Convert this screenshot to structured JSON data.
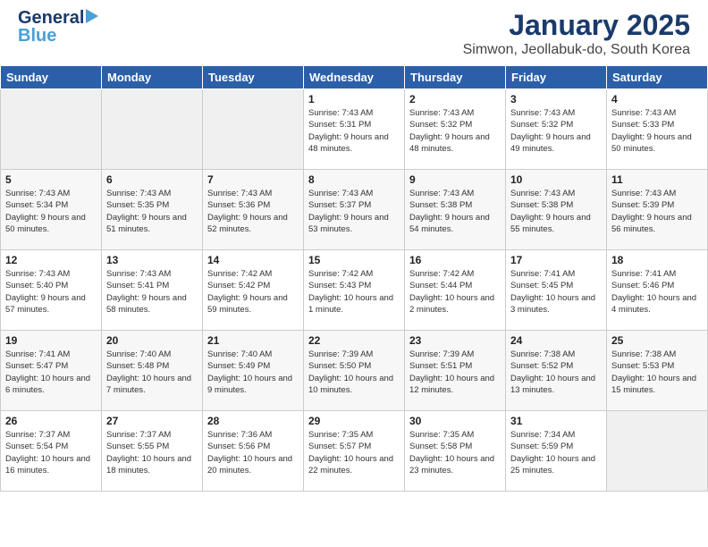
{
  "header": {
    "logo_line1": "General",
    "logo_line2": "Blue",
    "title": "January 2025",
    "subtitle": "Simwon, Jeollabuk-do, South Korea"
  },
  "weekdays": [
    "Sunday",
    "Monday",
    "Tuesday",
    "Wednesday",
    "Thursday",
    "Friday",
    "Saturday"
  ],
  "weeks": [
    [
      {
        "day": "",
        "sunrise": "",
        "sunset": "",
        "daylight": "",
        "empty": true
      },
      {
        "day": "",
        "sunrise": "",
        "sunset": "",
        "daylight": "",
        "empty": true
      },
      {
        "day": "",
        "sunrise": "",
        "sunset": "",
        "daylight": "",
        "empty": true
      },
      {
        "day": "1",
        "sunrise": "Sunrise: 7:43 AM",
        "sunset": "Sunset: 5:31 PM",
        "daylight": "Daylight: 9 hours and 48 minutes."
      },
      {
        "day": "2",
        "sunrise": "Sunrise: 7:43 AM",
        "sunset": "Sunset: 5:32 PM",
        "daylight": "Daylight: 9 hours and 48 minutes."
      },
      {
        "day": "3",
        "sunrise": "Sunrise: 7:43 AM",
        "sunset": "Sunset: 5:32 PM",
        "daylight": "Daylight: 9 hours and 49 minutes."
      },
      {
        "day": "4",
        "sunrise": "Sunrise: 7:43 AM",
        "sunset": "Sunset: 5:33 PM",
        "daylight": "Daylight: 9 hours and 50 minutes."
      }
    ],
    [
      {
        "day": "5",
        "sunrise": "Sunrise: 7:43 AM",
        "sunset": "Sunset: 5:34 PM",
        "daylight": "Daylight: 9 hours and 50 minutes."
      },
      {
        "day": "6",
        "sunrise": "Sunrise: 7:43 AM",
        "sunset": "Sunset: 5:35 PM",
        "daylight": "Daylight: 9 hours and 51 minutes."
      },
      {
        "day": "7",
        "sunrise": "Sunrise: 7:43 AM",
        "sunset": "Sunset: 5:36 PM",
        "daylight": "Daylight: 9 hours and 52 minutes."
      },
      {
        "day": "8",
        "sunrise": "Sunrise: 7:43 AM",
        "sunset": "Sunset: 5:37 PM",
        "daylight": "Daylight: 9 hours and 53 minutes."
      },
      {
        "day": "9",
        "sunrise": "Sunrise: 7:43 AM",
        "sunset": "Sunset: 5:38 PM",
        "daylight": "Daylight: 9 hours and 54 minutes."
      },
      {
        "day": "10",
        "sunrise": "Sunrise: 7:43 AM",
        "sunset": "Sunset: 5:38 PM",
        "daylight": "Daylight: 9 hours and 55 minutes."
      },
      {
        "day": "11",
        "sunrise": "Sunrise: 7:43 AM",
        "sunset": "Sunset: 5:39 PM",
        "daylight": "Daylight: 9 hours and 56 minutes."
      }
    ],
    [
      {
        "day": "12",
        "sunrise": "Sunrise: 7:43 AM",
        "sunset": "Sunset: 5:40 PM",
        "daylight": "Daylight: 9 hours and 57 minutes."
      },
      {
        "day": "13",
        "sunrise": "Sunrise: 7:43 AM",
        "sunset": "Sunset: 5:41 PM",
        "daylight": "Daylight: 9 hours and 58 minutes."
      },
      {
        "day": "14",
        "sunrise": "Sunrise: 7:42 AM",
        "sunset": "Sunset: 5:42 PM",
        "daylight": "Daylight: 9 hours and 59 minutes."
      },
      {
        "day": "15",
        "sunrise": "Sunrise: 7:42 AM",
        "sunset": "Sunset: 5:43 PM",
        "daylight": "Daylight: 10 hours and 1 minute."
      },
      {
        "day": "16",
        "sunrise": "Sunrise: 7:42 AM",
        "sunset": "Sunset: 5:44 PM",
        "daylight": "Daylight: 10 hours and 2 minutes."
      },
      {
        "day": "17",
        "sunrise": "Sunrise: 7:41 AM",
        "sunset": "Sunset: 5:45 PM",
        "daylight": "Daylight: 10 hours and 3 minutes."
      },
      {
        "day": "18",
        "sunrise": "Sunrise: 7:41 AM",
        "sunset": "Sunset: 5:46 PM",
        "daylight": "Daylight: 10 hours and 4 minutes."
      }
    ],
    [
      {
        "day": "19",
        "sunrise": "Sunrise: 7:41 AM",
        "sunset": "Sunset: 5:47 PM",
        "daylight": "Daylight: 10 hours and 6 minutes."
      },
      {
        "day": "20",
        "sunrise": "Sunrise: 7:40 AM",
        "sunset": "Sunset: 5:48 PM",
        "daylight": "Daylight: 10 hours and 7 minutes."
      },
      {
        "day": "21",
        "sunrise": "Sunrise: 7:40 AM",
        "sunset": "Sunset: 5:49 PM",
        "daylight": "Daylight: 10 hours and 9 minutes."
      },
      {
        "day": "22",
        "sunrise": "Sunrise: 7:39 AM",
        "sunset": "Sunset: 5:50 PM",
        "daylight": "Daylight: 10 hours and 10 minutes."
      },
      {
        "day": "23",
        "sunrise": "Sunrise: 7:39 AM",
        "sunset": "Sunset: 5:51 PM",
        "daylight": "Daylight: 10 hours and 12 minutes."
      },
      {
        "day": "24",
        "sunrise": "Sunrise: 7:38 AM",
        "sunset": "Sunset: 5:52 PM",
        "daylight": "Daylight: 10 hours and 13 minutes."
      },
      {
        "day": "25",
        "sunrise": "Sunrise: 7:38 AM",
        "sunset": "Sunset: 5:53 PM",
        "daylight": "Daylight: 10 hours and 15 minutes."
      }
    ],
    [
      {
        "day": "26",
        "sunrise": "Sunrise: 7:37 AM",
        "sunset": "Sunset: 5:54 PM",
        "daylight": "Daylight: 10 hours and 16 minutes."
      },
      {
        "day": "27",
        "sunrise": "Sunrise: 7:37 AM",
        "sunset": "Sunset: 5:55 PM",
        "daylight": "Daylight: 10 hours and 18 minutes."
      },
      {
        "day": "28",
        "sunrise": "Sunrise: 7:36 AM",
        "sunset": "Sunset: 5:56 PM",
        "daylight": "Daylight: 10 hours and 20 minutes."
      },
      {
        "day": "29",
        "sunrise": "Sunrise: 7:35 AM",
        "sunset": "Sunset: 5:57 PM",
        "daylight": "Daylight: 10 hours and 22 minutes."
      },
      {
        "day": "30",
        "sunrise": "Sunrise: 7:35 AM",
        "sunset": "Sunset: 5:58 PM",
        "daylight": "Daylight: 10 hours and 23 minutes."
      },
      {
        "day": "31",
        "sunrise": "Sunrise: 7:34 AM",
        "sunset": "Sunset: 5:59 PM",
        "daylight": "Daylight: 10 hours and 25 minutes."
      },
      {
        "day": "",
        "sunrise": "",
        "sunset": "",
        "daylight": "",
        "empty": true
      }
    ]
  ]
}
